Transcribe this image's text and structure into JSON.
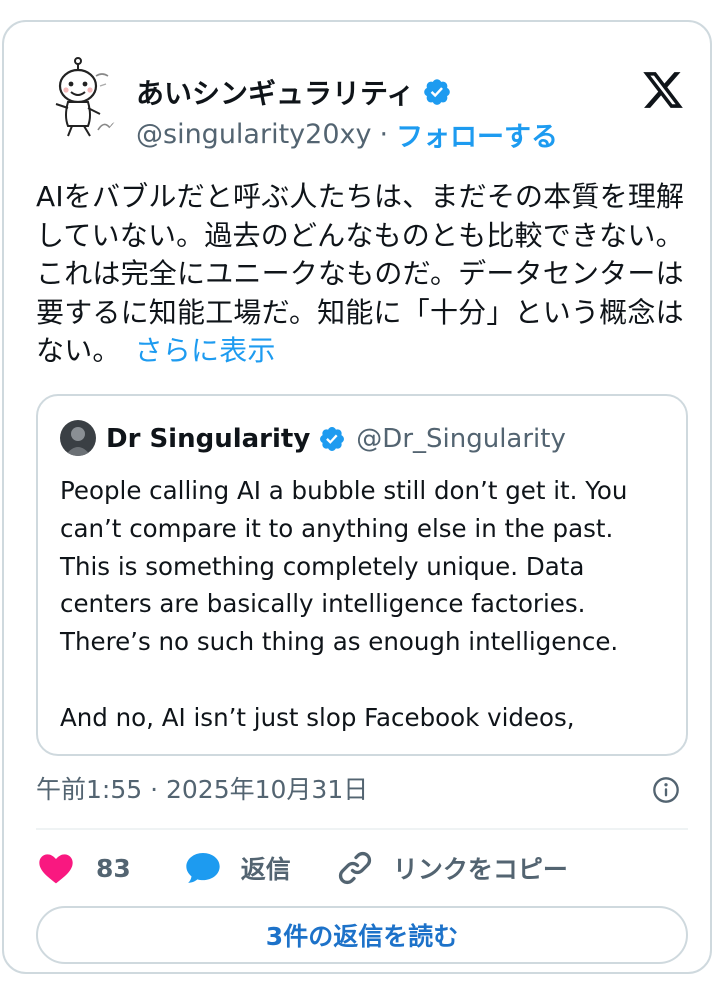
{
  "author": {
    "display_name": "あいシンギュラリティ",
    "handle": "@singularity20xy",
    "separator": "·",
    "follow_label": "フォローする",
    "verified_color": "#1d9bf0",
    "avatar_icon": "cartoon-character-avatar"
  },
  "tweet": {
    "lines": [
      "AIをバブルだと呼ぶ人たちは、まだその本質を理解",
      "していない。過去のどんなものとも比較できない。",
      "これは完全にユニークなものだ。データセンターは",
      "要するに知能工場だ。知能に「十分」という概念は",
      "ない。"
    ],
    "show_more": "さらに表示"
  },
  "quote": {
    "display_name": "Dr Singularity",
    "handle": "@Dr_Singularity",
    "lines": [
      "People calling AI a bubble still don’t get it. You",
      "can’t compare it to anything else in the past.",
      "This is something completely unique. Data",
      "centers are basically intelligence factories.",
      "There’s no such thing as enough intelligence.",
      "",
      "And no, AI isn’t just slop Facebook videos,"
    ]
  },
  "timestamp": "午前1:55 · 2025年10月31日",
  "actions": {
    "like_count": "83",
    "reply_label": "返信",
    "copy_link_label": "リンクをコピー",
    "like_color": "#f91880",
    "reply_color": "#1d9bf0"
  },
  "read_replies_label": "3件の返信を読む"
}
